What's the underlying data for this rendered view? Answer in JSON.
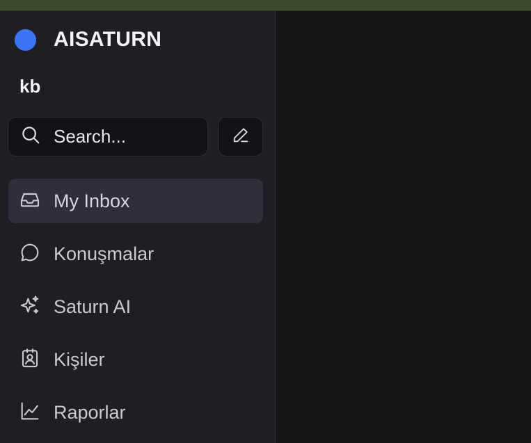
{
  "brand": {
    "name": "AISATURN",
    "accent_color": "#3b74f6"
  },
  "workspace": {
    "name": "kb"
  },
  "search": {
    "placeholder": "Search...",
    "icon": "search-icon"
  },
  "compose": {
    "icon": "pencil-icon"
  },
  "nav": {
    "active": "My Inbox",
    "items": [
      {
        "label": "My Inbox",
        "icon": "inbox-icon"
      },
      {
        "label": "Konuşmalar",
        "icon": "chat-bubble-icon"
      },
      {
        "label": "Saturn AI",
        "icon": "sparkles-icon"
      },
      {
        "label": "Kişiler",
        "icon": "contact-card-icon"
      },
      {
        "label": "Raporlar",
        "icon": "chart-line-icon"
      }
    ]
  }
}
